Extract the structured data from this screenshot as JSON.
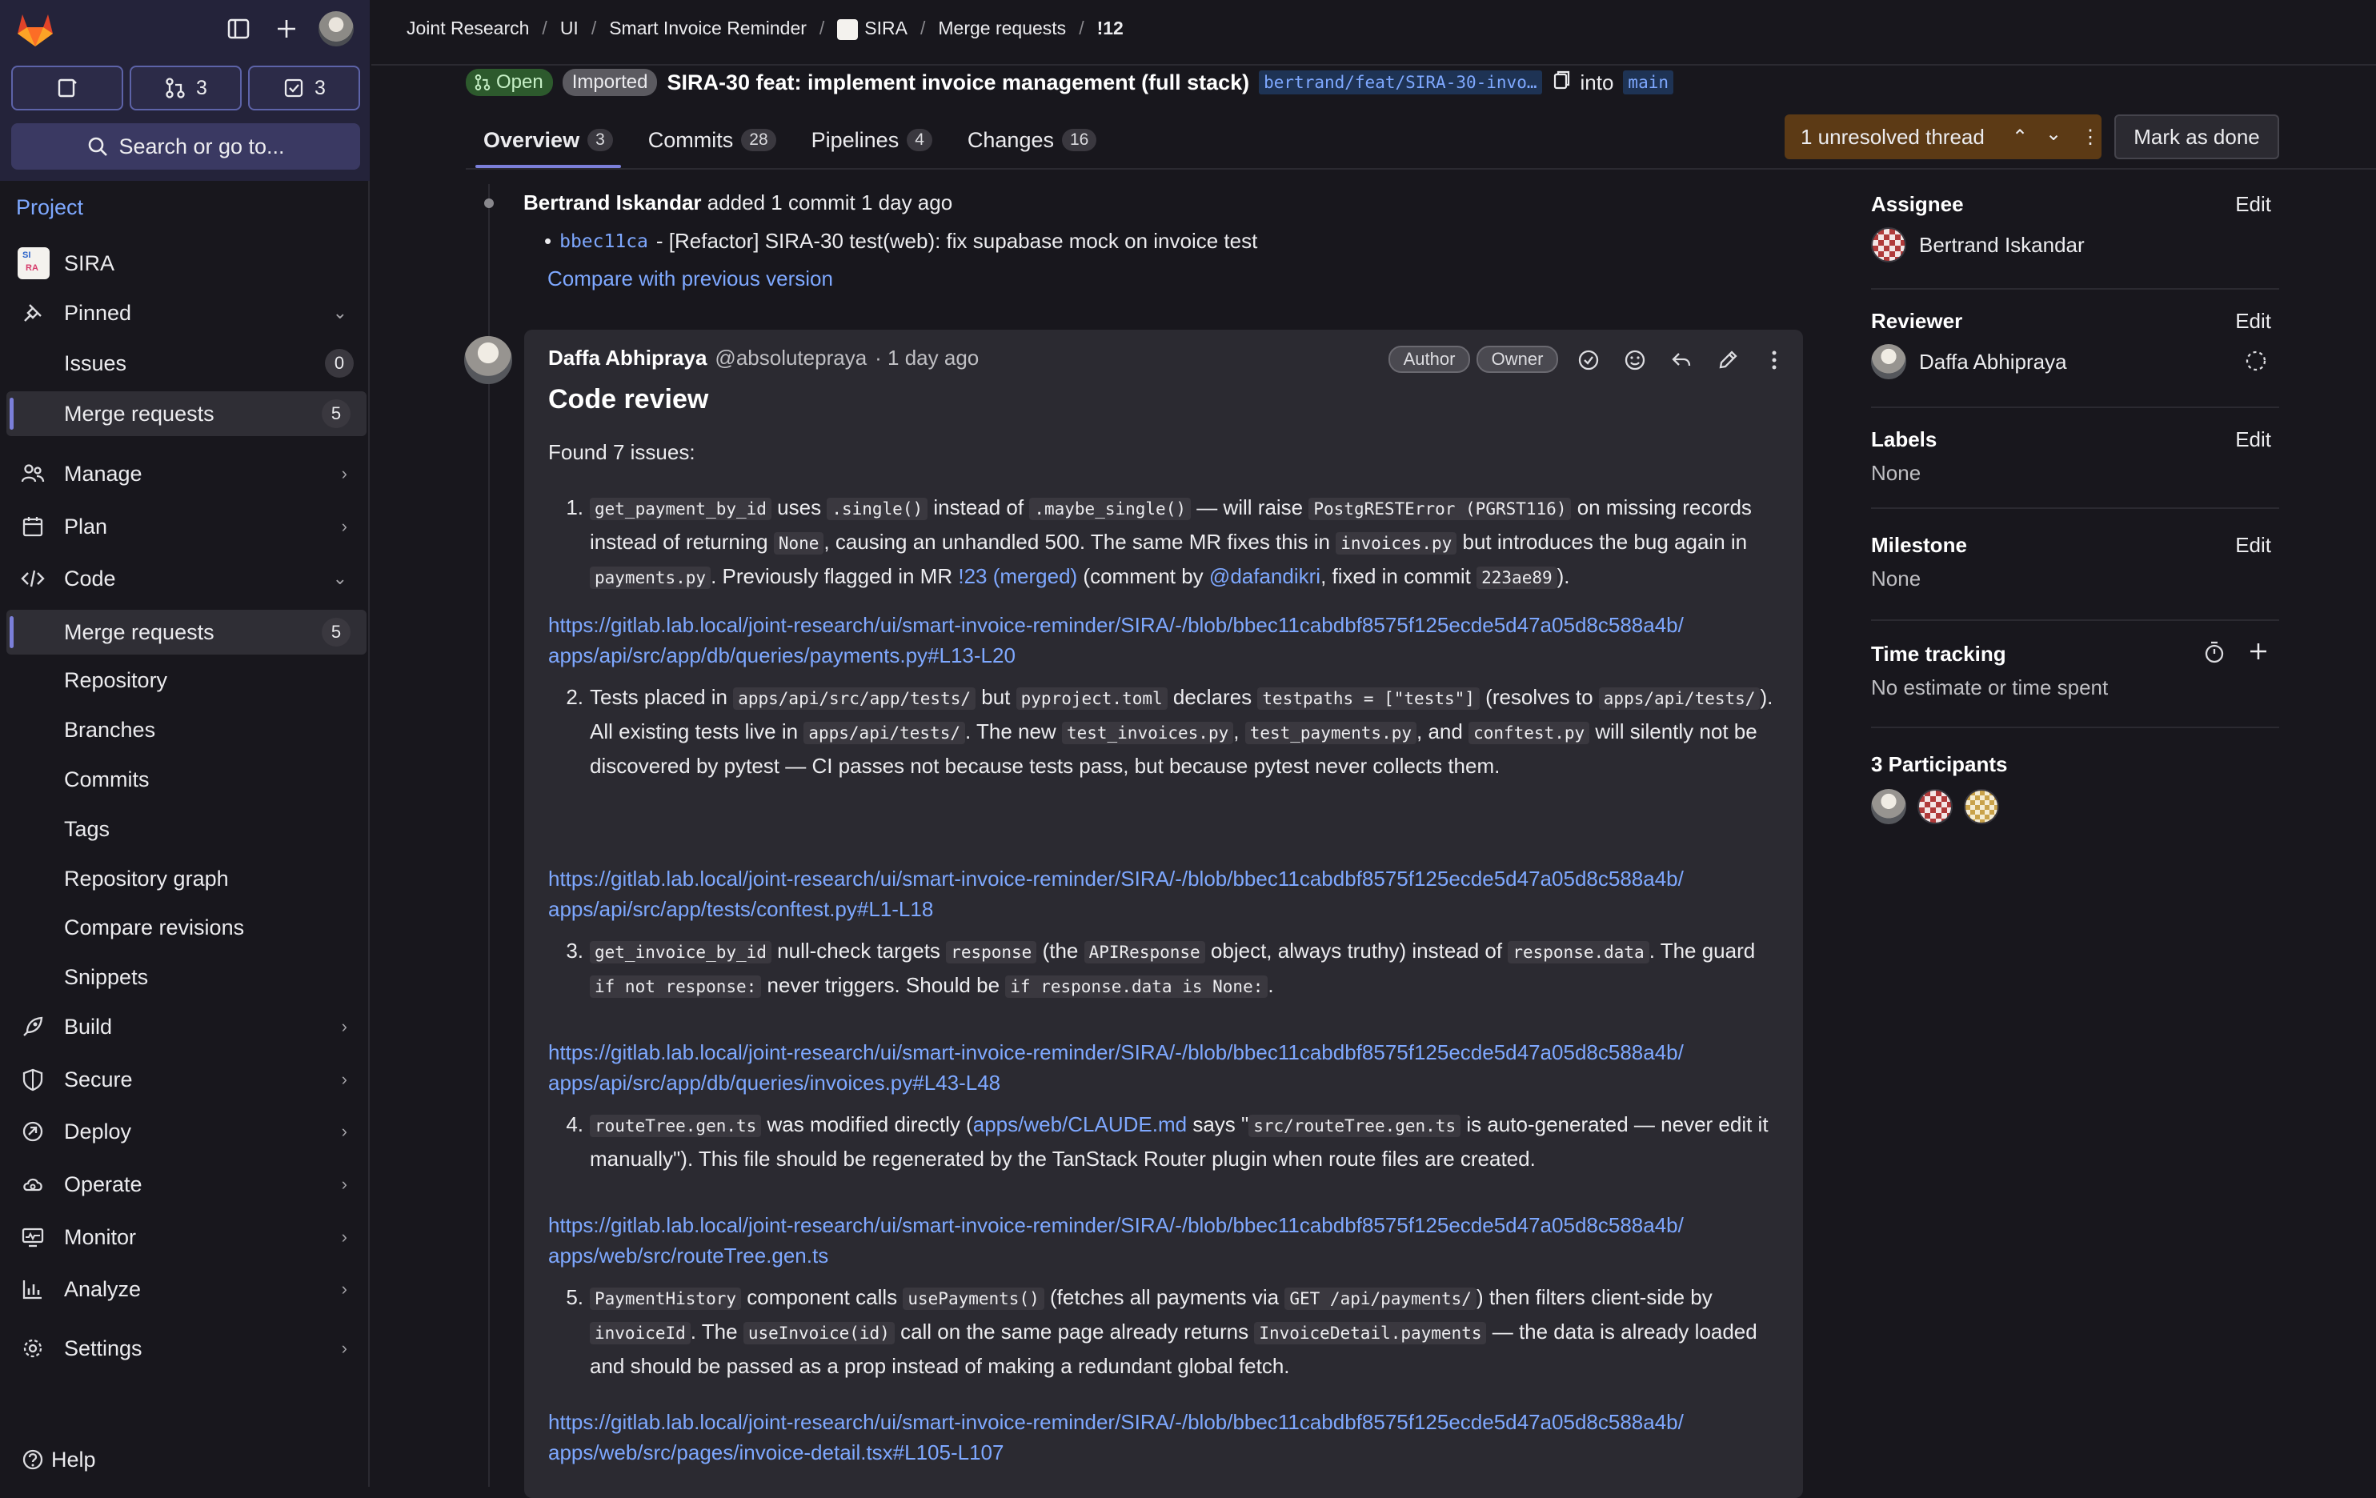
{
  "sidebar": {
    "counts": {
      "merge_requests": "3",
      "todos": "3"
    },
    "search_label": "Search or go to...",
    "section_label": "Project",
    "project_name": "SIRA",
    "pinned_label": "Pinned",
    "issues_label": "Issues",
    "issues_count": "0",
    "pinned_mr_label": "Merge requests",
    "pinned_mr_count": "5",
    "manage_label": "Manage",
    "plan_label": "Plan",
    "code_label": "Code",
    "code_items": [
      {
        "label": "Merge requests",
        "count": "5"
      },
      {
        "label": "Repository"
      },
      {
        "label": "Branches"
      },
      {
        "label": "Commits"
      },
      {
        "label": "Tags"
      },
      {
        "label": "Repository graph"
      },
      {
        "label": "Compare revisions"
      },
      {
        "label": "Snippets"
      }
    ],
    "build_label": "Build",
    "secure_label": "Secure",
    "deploy_label": "Deploy",
    "operate_label": "Operate",
    "monitor_label": "Monitor",
    "analyze_label": "Analyze",
    "settings_label": "Settings",
    "help_label": "Help"
  },
  "breadcrumb": [
    "Joint Research",
    "UI",
    "Smart Invoice Reminder",
    "SIRA",
    "Merge requests",
    "!12"
  ],
  "mr": {
    "status": "Open",
    "imported": "Imported",
    "title": "SIRA-30 feat: implement invoice management (full stack)",
    "source_branch": "bertrand/feat/SIRA-30-invo…",
    "into": "into",
    "target_branch": "main"
  },
  "tabs": [
    {
      "label": "Overview",
      "count": "3"
    },
    {
      "label": "Commits",
      "count": "28"
    },
    {
      "label": "Pipelines",
      "count": "4"
    },
    {
      "label": "Changes",
      "count": "16"
    }
  ],
  "threads": {
    "label": "1 unresolved thread"
  },
  "mark_done": "Mark as done",
  "activity": {
    "author": "Bertrand Iskandar",
    "action": "added 1 commit",
    "time": "1 day ago",
    "commit_sha": "bbec11ca",
    "commit_msg": "- [Refactor] SIRA-30 test(web): fix supabase mock on invoice test",
    "compare_link": "Compare with previous version"
  },
  "note": {
    "author": "Daffa Abhipraya",
    "handle": "@absolutepraya",
    "time": "· 1 day ago",
    "role_author": "Author",
    "role_owner": "Owner",
    "title": "Code review",
    "found": "Found 7 issues:",
    "issues": [
      {
        "num": "1.",
        "url1": "https://gitlab.lab.local/joint-research/ui/smart-invoice-reminder/SIRA/-/blob/bbec11cabdbf8575f125ecde5d47a05d8c588a4b/",
        "url2": "apps/api/src/app/db/queries/payments.py#L13-L20"
      },
      {
        "num": "2.",
        "url1": "https://gitlab.lab.local/joint-research/ui/smart-invoice-reminder/SIRA/-/blob/bbec11cabdbf8575f125ecde5d47a05d8c588a4b/",
        "url2": "apps/api/src/app/tests/conftest.py#L1-L18"
      },
      {
        "num": "3.",
        "url1": "https://gitlab.lab.local/joint-research/ui/smart-invoice-reminder/SIRA/-/blob/bbec11cabdbf8575f125ecde5d47a05d8c588a4b/",
        "url2": "apps/api/src/app/db/queries/invoices.py#L43-L48"
      },
      {
        "num": "4.",
        "url1": "https://gitlab.lab.local/joint-research/ui/smart-invoice-reminder/SIRA/-/blob/bbec11cabdbf8575f125ecde5d47a05d8c588a4b/",
        "url2": "apps/web/src/routeTree.gen.ts"
      },
      {
        "num": "5.",
        "url1": "https://gitlab.lab.local/joint-research/ui/smart-invoice-reminder/SIRA/-/blob/bbec11cabdbf8575f125ecde5d47a05d8c588a4b/",
        "url2": "apps/web/src/pages/invoice-detail.tsx#L105-L107"
      }
    ],
    "i1": {
      "c1": "get_payment_by_id",
      "t1": "uses",
      "c2": ".single()",
      "t2": "instead of",
      "c3": ".maybe_single()",
      "t3": "— will raise",
      "c4": "PostgRESTError (PGRST116)",
      "t4": "on missing records instead of returning",
      "c5": "None",
      "t5": ", causing an unhandled 500. The same MR fixes this in",
      "c6": "invoices.py",
      "t6": "but introduces the bug again in",
      "c7": "payments.py",
      "t7": ". Previously flagged in MR",
      "l1": "!23 (merged)",
      "t8": "(comment by",
      "l2": "@dafandikri",
      "t9": ", fixed in commit",
      "c8": "223ae89",
      "t10": ")."
    },
    "i2": {
      "t1": "Tests placed in",
      "c1": "apps/api/src/app/tests/",
      "t2": "but",
      "c2": "pyproject.toml",
      "t3": "declares",
      "c3": "testpaths = [\"tests\"]",
      "t4": "(resolves to",
      "c4": "apps/api/tests/",
      "t5": "). All existing tests live in",
      "c5": "apps/api/tests/",
      "t6": ". The new",
      "c6": "test_invoices.py",
      "t7": ",",
      "c7": "test_payments.py",
      "t8": ", and",
      "c8": "conftest.py",
      "t9": "will silently not be discovered by pytest — CI passes not because tests pass, but because pytest never collects them."
    },
    "i3": {
      "c1": "get_invoice_by_id",
      "t1": "null-check targets",
      "c2": "response",
      "t2": "(the",
      "c3": "APIResponse",
      "t3": "object, always truthy) instead of",
      "c4": "response.data",
      "t4": ". The guard",
      "c5": "if not response:",
      "t5": "never triggers. Should be",
      "c6": "if response.data is None:",
      "t6": "."
    },
    "i4": {
      "c1": "routeTree.gen.ts",
      "t1": "was modified directly (",
      "l1": "apps/web/CLAUDE.md",
      "t2": "says \"",
      "c2": "src/routeTree.gen.ts",
      "t3": "is auto-generated — never edit it manually\"). This file should be regenerated by the TanStack Router plugin when route files are created."
    },
    "i5": {
      "c1": "PaymentHistory",
      "t1": "component calls",
      "c2": "usePayments()",
      "t2": "(fetches all payments via",
      "c3": "GET /api/payments/",
      "t3": ") then filters client-side by",
      "c4": "invoiceId",
      "t4": ". The",
      "c5": "useInvoice(id)",
      "t5": "call on the same page already returns",
      "c6": "InvoiceDetail.payments",
      "t6": "— the data is already loaded and should be passed as a prop instead of making a redundant global fetch."
    }
  },
  "right": {
    "assignee_label": "Assignee",
    "assignee": "Bertrand Iskandar",
    "reviewer_label": "Reviewer",
    "reviewer": "Daffa Abhipraya",
    "labels_label": "Labels",
    "labels_value": "None",
    "milestone_label": "Milestone",
    "milestone_value": "None",
    "time_label": "Time tracking",
    "time_value": "No estimate or time spent",
    "participants_label": "3 Participants",
    "edit": "Edit"
  },
  "colors": {
    "accent": "#7b7fd9",
    "link": "#7ea8ff",
    "open_badge": "#2d5a2d",
    "thread_box": "#5c3a15"
  }
}
